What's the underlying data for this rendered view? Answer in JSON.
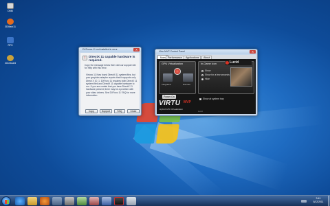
{
  "desktop": {
    "icons": [
      {
        "label": "DMB"
      },
      {
        "label": "3DMark11"
      },
      {
        "label": "RFS"
      },
      {
        "label": "4GoGuard"
      }
    ]
  },
  "dialog": {
    "title": "DXFuncs 11 not installed in error",
    "heading": "DirectX 11 capable hardware is required.",
    "intro": "Copy the message below then visit our support site for help with this error.",
    "message": "Virtuvo 11 Now found DirectX 11 system files, but your graphics adapter reports that it supports only Direct X 10_1. DXFunc 11 requires both DirectX 11 system files and DirectX 11 capable hardware to run. If you are certain that you have DirectX 11 hardware present, there may be a problem with your video drivers. See DXFunc 11 FAQ for more information.",
    "buttons": {
      "copy": "Copy",
      "support": "Support",
      "faq": "FAQ",
      "close": "Close"
    }
  },
  "virtu": {
    "title": "Virtu MVP Control Panel",
    "tabs": [
      "Main",
      "Performance",
      "Applications",
      "About"
    ],
    "panels": {
      "gpu": "GPU Virtualization",
      "ingame": "In-Game Icon"
    },
    "gpu_labels": {
      "left": "Integrated",
      "right": "Discrete"
    },
    "radio_options": [
      "Show",
      "Show for a few seconds",
      "Hide"
    ],
    "selected_option": "Hide",
    "checkbox_label": "Show at system tray",
    "power_button": "Power On",
    "brand": "Lucid",
    "logo_word": "VIRTU",
    "logo_suffix": "MVP",
    "logo_sub": "Hybrid GPU Virtualization",
    "footer": "Lucid"
  },
  "taskbar": {
    "time": "3:41",
    "date": "8/12/2011"
  },
  "colors": {
    "accent": "#d63325",
    "panel_dark": "#262626",
    "dialog_bg": "#f1f2f4"
  }
}
